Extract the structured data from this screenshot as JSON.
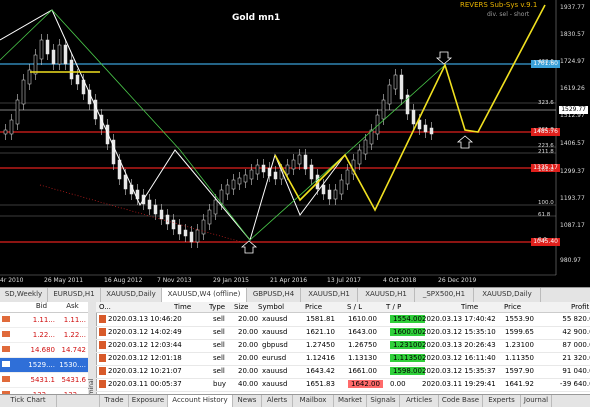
{
  "chart": {
    "title": "Gold mn1",
    "system_name": "REVERS Sub-Sys v.9.1",
    "system_sub": "div. sel - short",
    "price_ticks": [
      "1937.77",
      "1830.57",
      "1724.97",
      "1619.26",
      "1512.97",
      "1406.57",
      "1299.37",
      "1193.77",
      "1087.17",
      "980.97"
    ],
    "price_badges": [
      {
        "value": "1701.60",
        "color": "#3aa0d8"
      },
      {
        "value": "1529.77",
        "color": "#ffffff"
      },
      {
        "value": "1485.76",
        "color": "#e0201c"
      },
      {
        "value": "1335.17",
        "color": "#e0201c"
      },
      {
        "value": "1045.40",
        "color": "#e0201c"
      }
    ],
    "fib_labels": [
      "423.6",
      "323.6",
      "261.8",
      "223.6",
      "211.8",
      "161.8",
      "100.0",
      "61.8",
      "0.0"
    ],
    "x_labels": [
      "4r 2010",
      "26 May 2011",
      "16 Aug 2012",
      "7 Nov 2013",
      "29 Jan 2015",
      "21 Apr 2016",
      "13 Jul 2017",
      "4 Oct 2018",
      "26 Dec 2019"
    ]
  },
  "chart_tabs": [
    "SD,Weekly",
    "EURUSD,H1",
    "XAUUSD,Daily",
    "XAUUSD,W4 (offline)",
    "GBPUSD,H4",
    "XAUUSD,H1",
    "XAUUSD,H1",
    "_SPX500,H1",
    "XAUUSD,Daily"
  ],
  "market_watch": {
    "headers": {
      "symbol": "",
      "bid": "Bid",
      "ask": "Ask"
    },
    "rows": [
      {
        "bid": "1.11...",
        "ask": "1.11...",
        "bg": "#ffffff",
        "color": "#d01010"
      },
      {
        "bid": "1.22...",
        "ask": "1.22...",
        "bg": "#ffffff",
        "color": "#d01010"
      },
      {
        "bid": "14.680",
        "ask": "14.742",
        "bg": "#ffffff",
        "color": "#d01010"
      },
      {
        "bid": "1529....",
        "ask": "1530....",
        "bg": "#2f6fd8",
        "color": "#ffffff"
      },
      {
        "bid": "5431.1",
        "ask": "5431.6",
        "bg": "#ffffff",
        "color": "#d01010"
      },
      {
        "bid": "132....",
        "ask": "132....",
        "bg": "#ffffff",
        "color": "#d01010"
      }
    ],
    "tab": "Tick Chart"
  },
  "terminal": {
    "side_label": "Terminal",
    "headers": {
      "order": "O...",
      "time": "Time",
      "type": "Type",
      "size": "Size",
      "symbol": "Symbol",
      "price": "Price",
      "sl": "S / L",
      "tp": "T / P",
      "time2": "Time",
      "price2": "Price",
      "profit": "Profit"
    },
    "rows": [
      {
        "time": "2020.03.13 10:46:20",
        "type": "sell",
        "size": "20.00",
        "symbol": "xauusd",
        "price": "1581.81",
        "sl": "1610.00",
        "tp": "1554.00",
        "time2": "2020.03.13 17:40:42",
        "price2": "1553.90",
        "profit": "55 820.00",
        "tp_hi": true,
        "sl_hi": false
      },
      {
        "time": "2020.03.12 14:02:49",
        "type": "sell",
        "size": "20.00",
        "symbol": "xauusd",
        "price": "1621.10",
        "sl": "1643.00",
        "tp": "1600.00",
        "time2": "2020.03.12 15:35:10",
        "price2": "1599.65",
        "profit": "42 900.00",
        "tp_hi": true,
        "sl_hi": false
      },
      {
        "time": "2020.03.12 12:03:44",
        "type": "sell",
        "size": "20.00",
        "symbol": "gbpusd",
        "price": "1.27450",
        "sl": "1.26750",
        "tp": "1.23100",
        "time2": "2020.03.13 20:26:43",
        "price2": "1.23100",
        "profit": "87 000.00",
        "tp_hi": true,
        "sl_hi": false
      },
      {
        "time": "2020.03.12 12:01:18",
        "type": "sell",
        "size": "20.00",
        "symbol": "eurusd",
        "price": "1.12416",
        "sl": "1.13130",
        "tp": "1.11350",
        "time2": "2020.03.12 16:11:40",
        "price2": "1.11350",
        "profit": "21 320.00",
        "tp_hi": true,
        "sl_hi": false
      },
      {
        "time": "2020.03.12 10:21:07",
        "type": "sell",
        "size": "20.00",
        "symbol": "xauusd",
        "price": "1643.42",
        "sl": "1661.00",
        "tp": "1598.00",
        "time2": "2020.03.12 15:35:37",
        "price2": "1597.90",
        "profit": "91 040.00",
        "tp_hi": true,
        "sl_hi": false
      },
      {
        "time": "2020.03.11 00:05:37",
        "type": "buy",
        "size": "40.00",
        "symbol": "xauusd",
        "price": "1651.83",
        "sl": "1642.00",
        "tp": "0.00",
        "time2": "2020.03.11 19:29:41",
        "price2": "1641.92",
        "profit": "-39 640.00",
        "tp_hi": false,
        "sl_hi": true
      }
    ],
    "colors": {
      "tp_green": "#2fcf3a",
      "sl_red": "#ff6b6b"
    }
  },
  "bottom_tabs": [
    "Trade",
    "Exposure",
    "Account History",
    "News",
    "Alerts",
    "Mailbox",
    "Market",
    "Signals",
    "Articles",
    "Code Base",
    "Experts",
    "Journal"
  ]
}
